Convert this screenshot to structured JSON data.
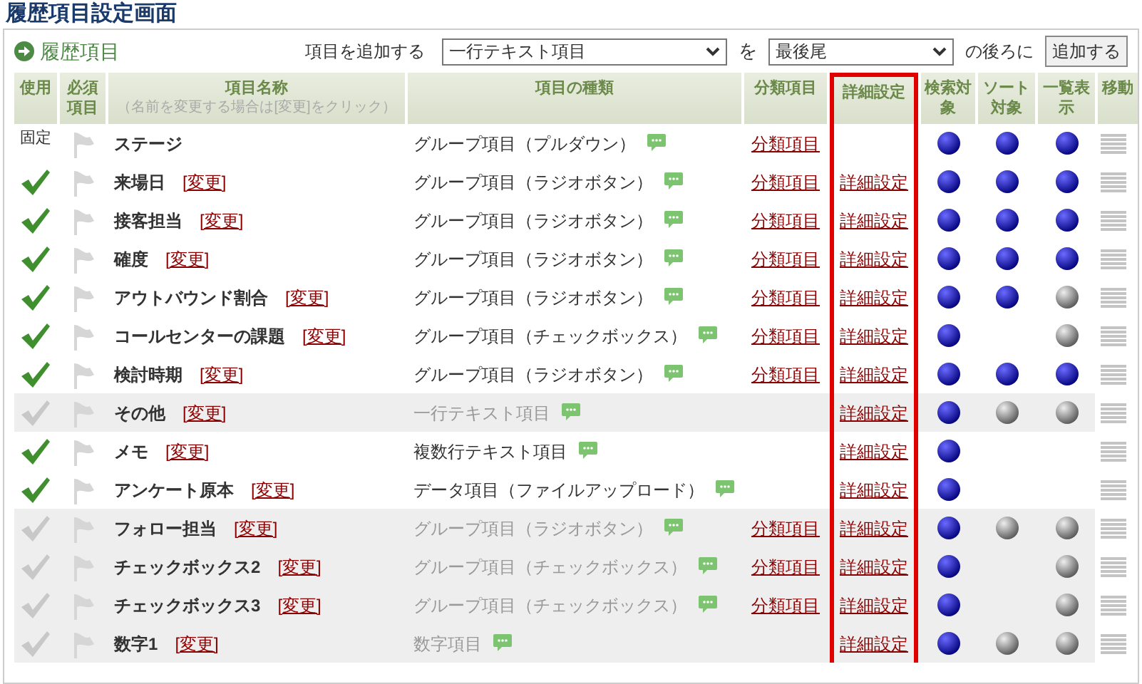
{
  "page_title": "履歴項目設定画面",
  "section": {
    "title": "履歴項目"
  },
  "add_bar": {
    "label": "項目を追加する",
    "type_select": "一行テキスト項目",
    "particle": "を",
    "position_select": "最後尾",
    "suffix": "の後ろに",
    "button": "追加する"
  },
  "table": {
    "columns": [
      {
        "kind": "plain",
        "label": "使用"
      },
      {
        "kind": "plain",
        "label": "必須項目"
      },
      {
        "kind": "name",
        "label": "項目名称",
        "hint": "（名前を変更する場合は[変更]をクリック）"
      },
      {
        "kind": "plain",
        "label": "項目の種類"
      },
      {
        "kind": "plain",
        "label": "分類項目"
      },
      {
        "kind": "highlight",
        "label": "詳細設定"
      },
      {
        "kind": "plain",
        "label": "検索対象"
      },
      {
        "kind": "plain",
        "label": "ソート対象"
      },
      {
        "kind": "plain",
        "label": "一覧表示"
      },
      {
        "kind": "plain",
        "label": "移動"
      }
    ],
    "rows": [
      {
        "fixed_label": "固定",
        "name": "ステージ",
        "type": "グループ項目（プルダウン）",
        "category": "分類項目",
        "search": true,
        "sort": true,
        "list": true
      },
      {
        "used": true,
        "name": "来場日",
        "rename": "[変更]",
        "type": "グループ項目（ラジオボタン）",
        "category": "分類項目",
        "detail": "詳細設定",
        "search": true,
        "sort": true,
        "list": true
      },
      {
        "used": true,
        "name": "接客担当",
        "rename": "[変更]",
        "type": "グループ項目（ラジオボタン）",
        "category": "分類項目",
        "detail": "詳細設定",
        "search": true,
        "sort": true,
        "list": true
      },
      {
        "used": true,
        "name": "確度",
        "rename": "[変更]",
        "type": "グループ項目（ラジオボタン）",
        "category": "分類項目",
        "detail": "詳細設定",
        "search": true,
        "sort": true,
        "list": true
      },
      {
        "used": true,
        "name": "アウトバウンド割合",
        "rename": "[変更]",
        "type": "グループ項目（ラジオボタン）",
        "category": "分類項目",
        "detail": "詳細設定",
        "search": true,
        "sort": true,
        "list": false
      },
      {
        "used": true,
        "name": "コールセンターの課題",
        "rename": "[変更]",
        "type": "グループ項目（チェックボックス）",
        "category": "分類項目",
        "detail": "詳細設定",
        "search": true,
        "list": false
      },
      {
        "used": true,
        "name": "検討時期",
        "rename": "[変更]",
        "type": "グループ項目（ラジオボタン）",
        "category": "分類項目",
        "detail": "詳細設定",
        "search": true,
        "sort": true,
        "list": true
      },
      {
        "used": false,
        "name": "その他",
        "rename": "[変更]",
        "type": "一行テキスト項目",
        "detail": "詳細設定",
        "search": true,
        "sort": false,
        "list": false
      },
      {
        "used": true,
        "name": "メモ",
        "rename": "[変更]",
        "type": "複数行テキスト項目",
        "detail": "詳細設定",
        "search": true
      },
      {
        "used": true,
        "name": "アンケート原本",
        "rename": "[変更]",
        "type": "データ項目（ファイルアップロード）",
        "detail": "詳細設定",
        "search": true
      },
      {
        "used": false,
        "name": "フォロー担当",
        "rename": "[変更]",
        "type": "グループ項目（ラジオボタン）",
        "category": "分類項目",
        "detail": "詳細設定",
        "search": true,
        "sort": false,
        "list": false
      },
      {
        "used": false,
        "name": "チェックボックス2",
        "rename": "[変更]",
        "type": "グループ項目（チェックボックス）",
        "category": "分類項目",
        "detail": "詳細設定",
        "search": true,
        "list": false
      },
      {
        "used": false,
        "name": "チェックボックス3",
        "rename": "[変更]",
        "type": "グループ項目（チェックボックス）",
        "category": "分類項目",
        "detail": "詳細設定",
        "search": true,
        "list": false
      },
      {
        "used": false,
        "name": "数字1",
        "rename": "[変更]",
        "type": "数字項目",
        "detail": "詳細設定",
        "search": true,
        "sort": false,
        "list": false
      }
    ]
  }
}
